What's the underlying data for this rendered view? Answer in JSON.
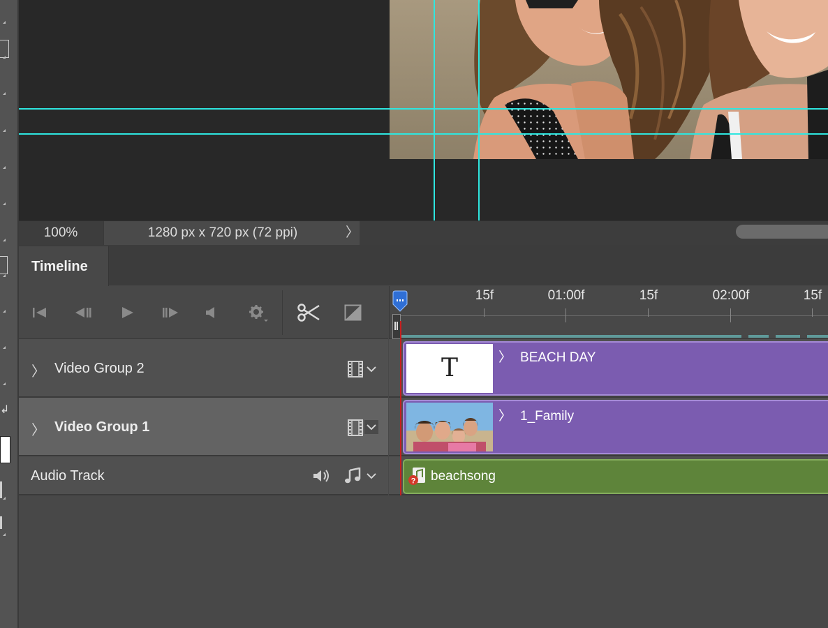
{
  "status_bar": {
    "zoom": "100%",
    "document_size": "1280 px x 720 px (72 ppi)",
    "more_arrow": "〉"
  },
  "timeline": {
    "tab_label": "Timeline",
    "ruler_labels": [
      "15f",
      "01:00f",
      "15f",
      "02:00f",
      "15f"
    ],
    "tracks": [
      {
        "name": "Video Group 2",
        "clip_label": "BEACH DAY",
        "clip_icon": "text-layer-icon",
        "thumb_text": "T"
      },
      {
        "name": "Video Group 1",
        "clip_label": "1_Family",
        "clip_icon": "photo-thumbnail",
        "selected": true
      },
      {
        "name": "Audio Track",
        "clip_label": "beachsong",
        "clip_icon": "missing-audio-icon"
      }
    ],
    "controls": [
      "go-to-first-frame-icon",
      "previous-frame-icon",
      "play-icon",
      "next-frame-icon",
      "mute-icon",
      "settings-icon",
      "split-at-playhead-icon",
      "transition-icon"
    ]
  },
  "colors": {
    "guide": "#2ee6e0",
    "video_clip": "#7b5cb0",
    "audio_clip": "#5e843a",
    "playhead": "#c81e1e",
    "playhead_marker": "#2f6fd6"
  }
}
